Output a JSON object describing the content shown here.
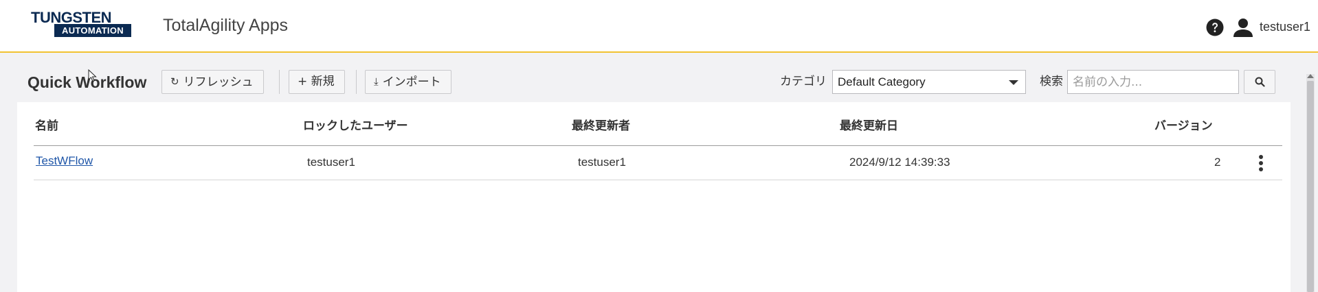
{
  "header": {
    "logo_top": "TUNGSTEN",
    "logo_bottom": "AUTOMATION",
    "app_title": "TotalAgility Apps",
    "help_icon": "question-circle-icon",
    "user_icon": "person-icon",
    "username": "testuser1",
    "accent_color": "#f2c230"
  },
  "toolbar": {
    "page_title": "Quick Workflow",
    "refresh_label": "リフレッシュ",
    "new_label": "+ 新規",
    "import_label": "インポート",
    "category_label": "カテゴリ",
    "category_value": "Default Category",
    "search_label": "検索",
    "search_placeholder": "名前の入力...",
    "search_value": ""
  },
  "table": {
    "columns": [
      "名前",
      "ロックしたユーザー",
      "最終更新者",
      "最終更新日",
      "バージョン"
    ],
    "rows": [
      {
        "name": "TestWFlow",
        "locked_by": "testuser1",
        "last_modified_by": "testuser1",
        "last_modified_date": "2024/9/12 14:39:33",
        "version": "2"
      }
    ],
    "link_color": "#1f56a8"
  }
}
